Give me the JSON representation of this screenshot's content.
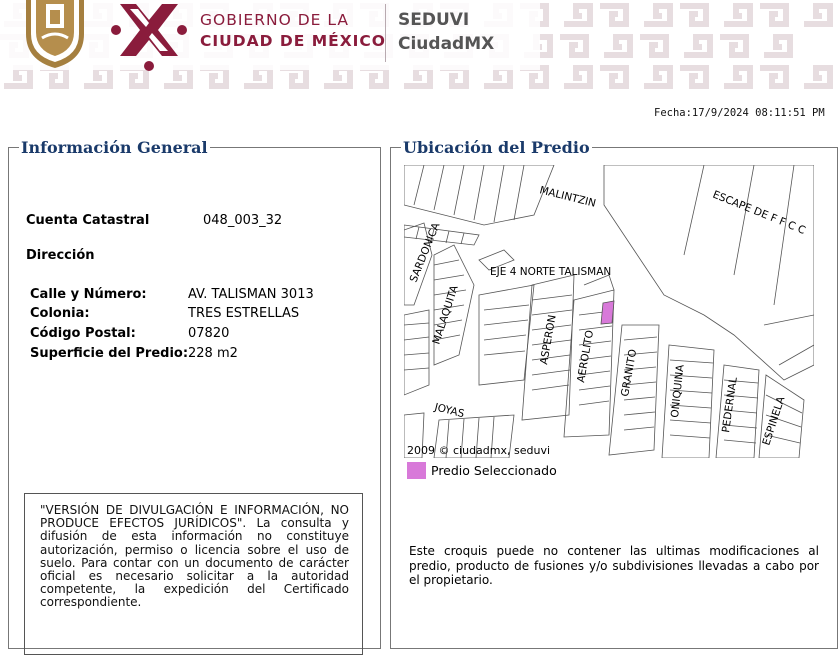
{
  "header": {
    "gov_line1": "GOBIERNO DE LA",
    "gov_line2": "CIUDAD DE MÉXICO",
    "agency_line1": "SEDUVI",
    "agency_line2": "CiudadMX",
    "brand_color": "#8a1c3c"
  },
  "fecha": "Fecha:17/9/2024 08:11:51 PM",
  "info": {
    "title": "Información General",
    "cuenta_label": "Cuenta Catastral",
    "cuenta_value": "048_003_32",
    "direccion_label": "Dirección",
    "calle_label": "Calle y Número:",
    "calle_value": "AV. TALISMAN 3013",
    "colonia_label": "Colonia:",
    "colonia_value": "TRES ESTRELLAS",
    "cp_label": "Código Postal:",
    "cp_value": "07820",
    "superficie_label": "Superficie del Predio:",
    "superficie_value": "228 m2",
    "disclaimer": "\"VERSIÓN DE DIVULGACIÓN E INFORMACIÓN, NO PRODUCE EFECTOS JURÍDICOS\". La consulta y difusión de esta información no constituye autorización, permiso o licencia sobre el uso de suelo. Para contar con un documento de carácter oficial es necesario solicitar a la autoridad competente, la expedición del Certificado correspondiente."
  },
  "ubicacion": {
    "title": "Ubicación del Predio",
    "streets": {
      "malintzin": "MALINTZIN",
      "escape": "ESCAPE DE F F C C",
      "eje4": "EJE 4 NORTE TALISMAN",
      "sardonica": "SARDONICA",
      "malaquita": "MALAQUITA",
      "asperon": "ASPERON",
      "aerolito": "AEROLITO",
      "granito": "GRANITO",
      "oniquina": "ONIQUINA",
      "pedernal": "PEDERNAL",
      "espinela": "ESPINELA",
      "joyas": "JOYAS"
    },
    "copyright": "2009 © ciudadmx, seduvi",
    "legend_label": "Predio Seleccionado",
    "legend_color": "#d879d9",
    "note": "Este croquis puede no contener las ultimas modificaciones al predio, producto de fusiones y/o subdivisiones llevadas a cabo por el propietario."
  }
}
